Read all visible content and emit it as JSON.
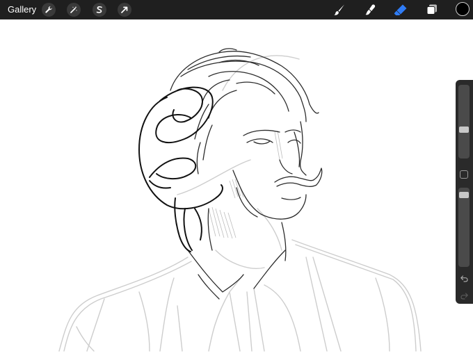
{
  "toolbar": {
    "gallery_label": "Gallery",
    "left_icons": [
      "wrench-icon",
      "magic-wand-icon",
      "selection-s-icon",
      "transform-arrow-icon"
    ],
    "right_tools": [
      "brush-icon",
      "smudge-icon",
      "eraser-icon",
      "layers-icon"
    ],
    "active_tool": "eraser",
    "active_color": "#2f7cf6",
    "current_color": "#000000"
  },
  "sidebar": {
    "brush_size": 0.38,
    "opacity": 0.94,
    "icons": [
      "modify-square-icon",
      "undo-icon",
      "redo-icon"
    ]
  }
}
